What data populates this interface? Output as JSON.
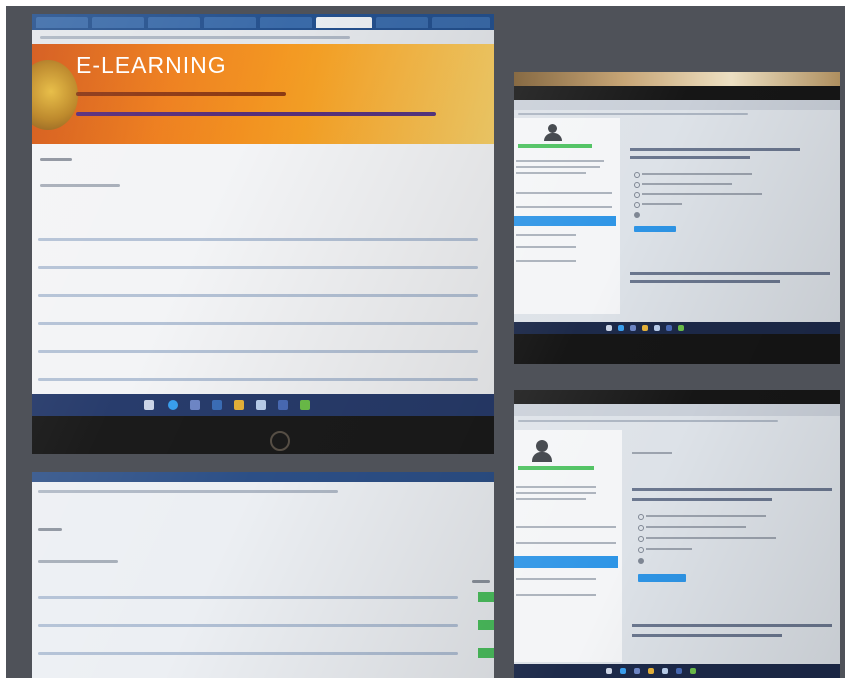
{
  "collage": {
    "photos": [
      {
        "name": "large-monitor-photo",
        "banner_title": "E-LEARNING"
      },
      {
        "name": "quiz-screen-photo-top"
      },
      {
        "name": "course-list-photo"
      },
      {
        "name": "quiz-screen-photo-bottom"
      }
    ]
  },
  "colors": {
    "board_bg": "#4f5259",
    "banner_orange": "#ee7d1a",
    "browser_blue": "#24508d",
    "moodle_blue": "#2e95e6",
    "progress_green": "#4cc15f"
  },
  "icons": [
    "laptop-brand-logo-icon",
    "windows-start-icon",
    "browser-icon",
    "user-avatar-icon"
  ]
}
